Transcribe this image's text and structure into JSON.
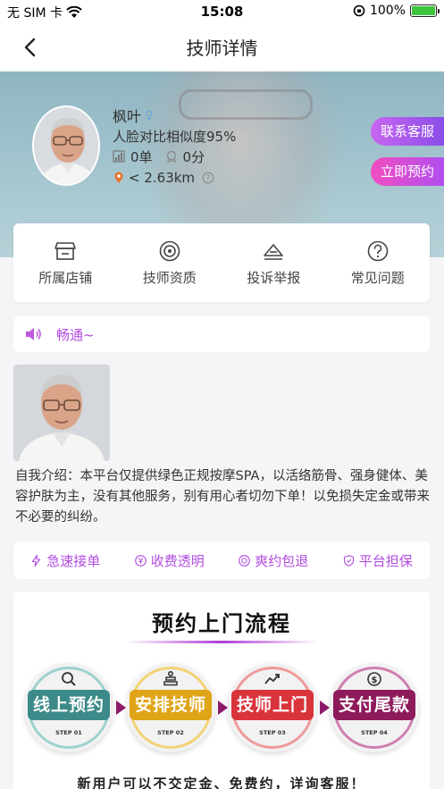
{
  "status": {
    "carrier": "无 SIM 卡",
    "time": "15:08",
    "battery": "100%",
    "battery_level": 1.0
  },
  "nav": {
    "title": "技师详情",
    "back_icon": "chevron-left-icon"
  },
  "profile": {
    "name": "枫叶",
    "gender_symbol": "♀",
    "similarity": "人脸对比相似度95%",
    "orders": "0单",
    "rating": "0分",
    "distance": "< 2.63km",
    "help_icon": "question-icon"
  },
  "actions": {
    "contact_label": "联系客服",
    "book_label": "立即预约"
  },
  "menu": [
    {
      "label": "所属店铺",
      "icon": "store-icon"
    },
    {
      "label": "技师资质",
      "icon": "certificate-icon"
    },
    {
      "label": "投诉举报",
      "icon": "complaint-icon"
    },
    {
      "label": "常见问题",
      "icon": "question-circle-icon"
    }
  ],
  "notice": {
    "text": "畅通~",
    "icon": "speaker-icon"
  },
  "intro": "自我介绍：本平台仅提供绿色正规按摩SPA，以活络筋骨、强身健体、美容护肤为主，没有其他服务，别有用心者切勿下单！以免损失定金或带来不必要的纠纷。",
  "features": [
    {
      "label": "急速接单",
      "icon": "lightning-icon"
    },
    {
      "label": "收费透明",
      "icon": "yen-icon"
    },
    {
      "label": "爽约包退",
      "icon": "refund-icon"
    },
    {
      "label": "平台担保",
      "icon": "shield-icon"
    }
  ],
  "process": {
    "title": "预约上门流程",
    "steps": [
      {
        "label": "线上预约",
        "step": "STEP 01",
        "color": "#3d8a8a",
        "ring": "#9ed1cf",
        "icon": "search-icon"
      },
      {
        "label": "安排技师",
        "step": "STEP 02",
        "color": "#e0a417",
        "ring": "#f3d275",
        "icon": "stack-icon"
      },
      {
        "label": "技师上门",
        "step": "STEP 03",
        "color": "#d9343c",
        "ring": "#ef9a9a",
        "icon": "trend-icon"
      },
      {
        "label": "支付尾款",
        "step": "STEP 04",
        "color": "#8e1a5c",
        "ring": "#cf7fb0",
        "icon": "payment-icon"
      }
    ],
    "footer": "新用户可以不交定金、免费约，详询客服！"
  },
  "colors": {
    "accent": "#b14ce0",
    "contact_gradient": "#c866f0",
    "book_gradient": "#f04ec0"
  }
}
